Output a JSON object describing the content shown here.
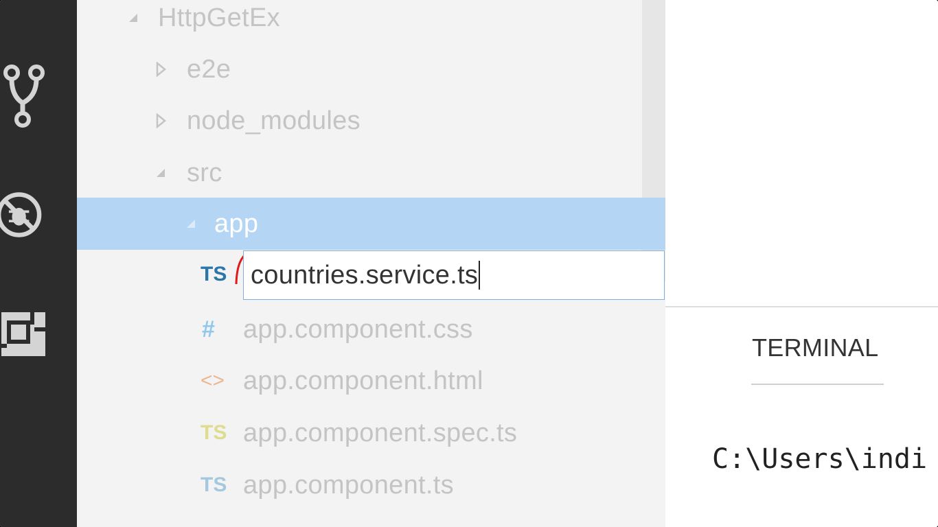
{
  "activity_bar": {
    "icons": [
      "source-control-icon",
      "debug-icon",
      "extensions-icon"
    ]
  },
  "explorer": {
    "project": {
      "label": "HttpGetEx",
      "expanded": true
    },
    "folders": [
      {
        "label": "e2e",
        "expanded": false
      },
      {
        "label": "node_modules",
        "expanded": false
      },
      {
        "label": "src",
        "expanded": true
      },
      {
        "label": "app",
        "expanded": true,
        "selected": true
      }
    ],
    "rename": {
      "icon_text": "TS",
      "value": "countries.service.ts"
    },
    "files": [
      {
        "icon_text": "#",
        "label": "app.component.css",
        "icon_color": "#8fc8ec"
      },
      {
        "icon_text": "<>",
        "label": "app.component.html",
        "icon_color": "#e9b893"
      },
      {
        "icon_text": "TS",
        "label": "app.component.spec.ts",
        "icon_color": "#dedc8f"
      },
      {
        "icon_text": "TS",
        "label": "app.component.ts",
        "icon_color": "#a6c8de"
      }
    ]
  },
  "panel": {
    "tab_label": "TERMINAL",
    "terminal_line": "C:\\Users\\indi"
  },
  "colors": {
    "activity_bar_bg": "#2c2c2c",
    "explorer_bg": "#f3f3f3",
    "selection_bg": "#b5d5f5",
    "ts_icon": "#2b75a8",
    "rename_border": "#7eaedc"
  }
}
